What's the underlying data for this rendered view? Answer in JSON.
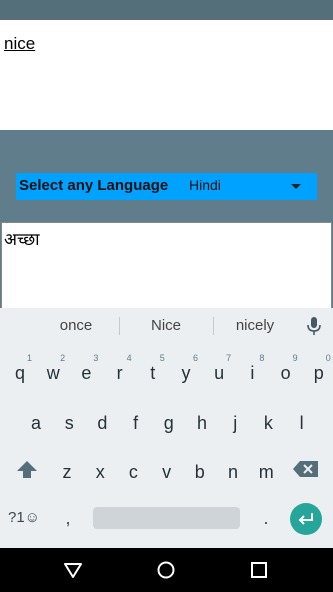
{
  "input": {
    "text": "nice"
  },
  "language": {
    "label": "Select any Language",
    "selected": "Hindi"
  },
  "output": {
    "text": "अच्छा"
  },
  "keyboard": {
    "suggestions": [
      "once",
      "Nice",
      "nicely"
    ],
    "row1": [
      {
        "k": "q",
        "h": "1"
      },
      {
        "k": "w",
        "h": "2"
      },
      {
        "k": "e",
        "h": "3"
      },
      {
        "k": "r",
        "h": "4"
      },
      {
        "k": "t",
        "h": "5"
      },
      {
        "k": "y",
        "h": "6"
      },
      {
        "k": "u",
        "h": "7"
      },
      {
        "k": "i",
        "h": "8"
      },
      {
        "k": "o",
        "h": "9"
      },
      {
        "k": "p",
        "h": "0"
      }
    ],
    "row2": [
      "a",
      "s",
      "d",
      "f",
      "g",
      "h",
      "j",
      "k",
      "l"
    ],
    "row3": [
      "z",
      "x",
      "c",
      "v",
      "b",
      "n",
      "m"
    ],
    "symbols_label": "?1☺",
    "comma": ",",
    "period": "."
  },
  "colors": {
    "background": "#607d8b",
    "language_bar": "#00a2ff",
    "enter_key": "#26a69a",
    "keyboard": "#eceff1"
  }
}
